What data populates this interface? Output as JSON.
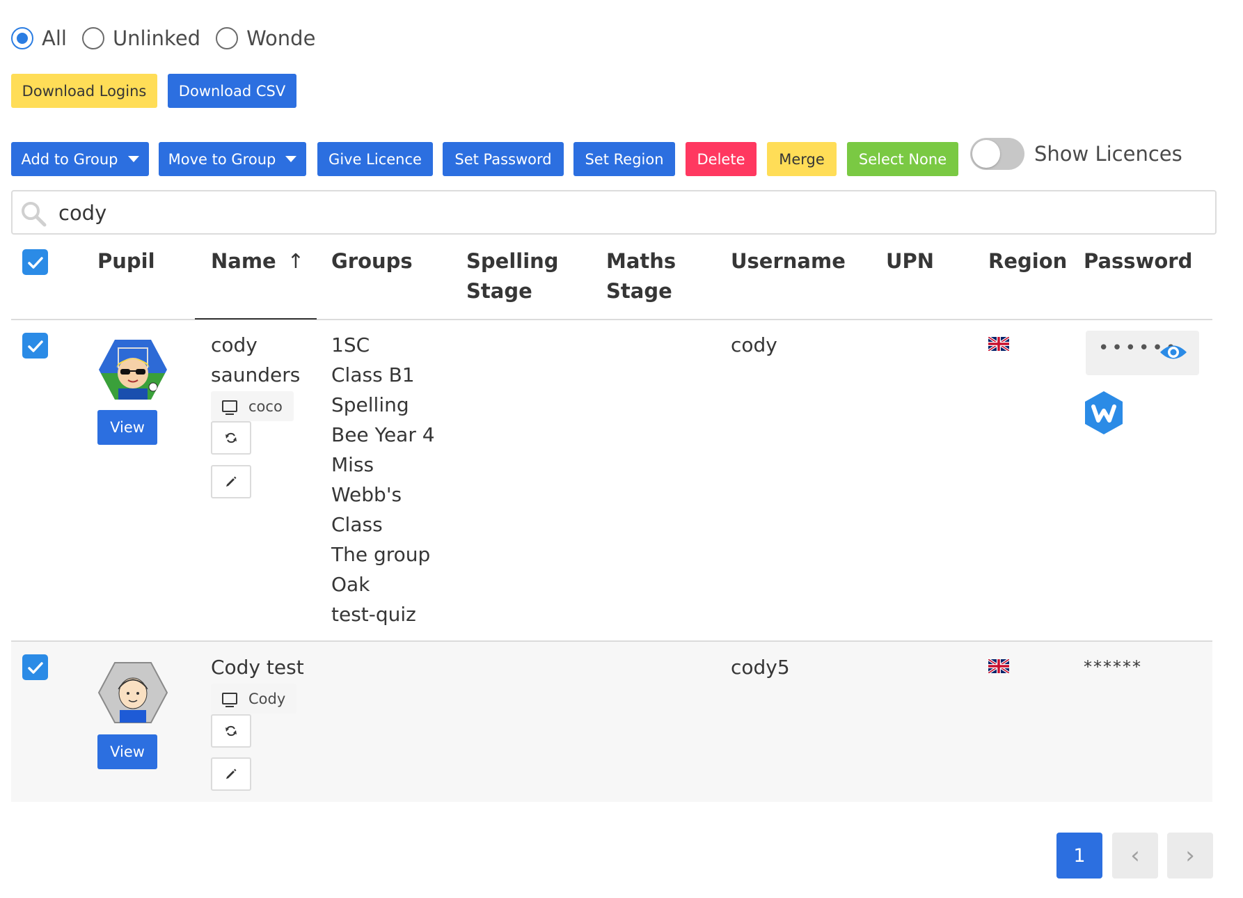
{
  "filters": {
    "options": [
      {
        "label": "All",
        "selected": true
      },
      {
        "label": "Unlinked",
        "selected": false
      },
      {
        "label": "Wonde",
        "selected": false
      }
    ]
  },
  "downloads": {
    "logins_label": "Download Logins",
    "csv_label": "Download CSV"
  },
  "toolbar": {
    "add_to_group": "Add to Group",
    "move_to_group": "Move to Group",
    "give_licence": "Give Licence",
    "set_password": "Set Password",
    "set_region": "Set Region",
    "delete": "Delete",
    "merge": "Merge",
    "select_none": "Select None",
    "show_licences_label": "Show Licences",
    "show_licences_on": false
  },
  "search": {
    "value": "cody"
  },
  "table": {
    "headers": {
      "pupil": "Pupil",
      "name": "Name",
      "groups": "Groups",
      "spelling_stage_1": "Spelling",
      "spelling_stage_2": "Stage",
      "maths_stage_1": "Maths",
      "maths_stage_2": "Stage",
      "username": "Username",
      "upn": "UPN",
      "region": "Region",
      "password": "Password"
    },
    "sort_arrow": "↑",
    "rows": [
      {
        "selected": true,
        "view_label": "View",
        "name_line1": "cody",
        "name_line2": "saunders",
        "login_tag": "coco",
        "groups": [
          "1SC",
          "Class B1",
          "Spelling",
          "Bee Year 4",
          "Miss",
          "Webb's",
          "Class",
          "The group",
          "Oak",
          "test-quiz"
        ],
        "username": "cody",
        "region_icon": "uk-flag-icon",
        "password": "••••••",
        "wonde_icon": "wonde-logo-icon"
      },
      {
        "selected": true,
        "view_label": "View",
        "name_line1": "Cody test",
        "login_tag": "Cody",
        "groups": [],
        "username": "cody5",
        "region_icon": "uk-flag-icon",
        "password": "******"
      }
    ]
  },
  "pagination": {
    "current": "1",
    "prev": "‹",
    "next": "›"
  },
  "colors": {
    "primary": "#2c6fe0",
    "yellow": "#ffdd57",
    "red": "#ff3860",
    "green": "#7ac943",
    "checkbox": "#2b8be6"
  }
}
